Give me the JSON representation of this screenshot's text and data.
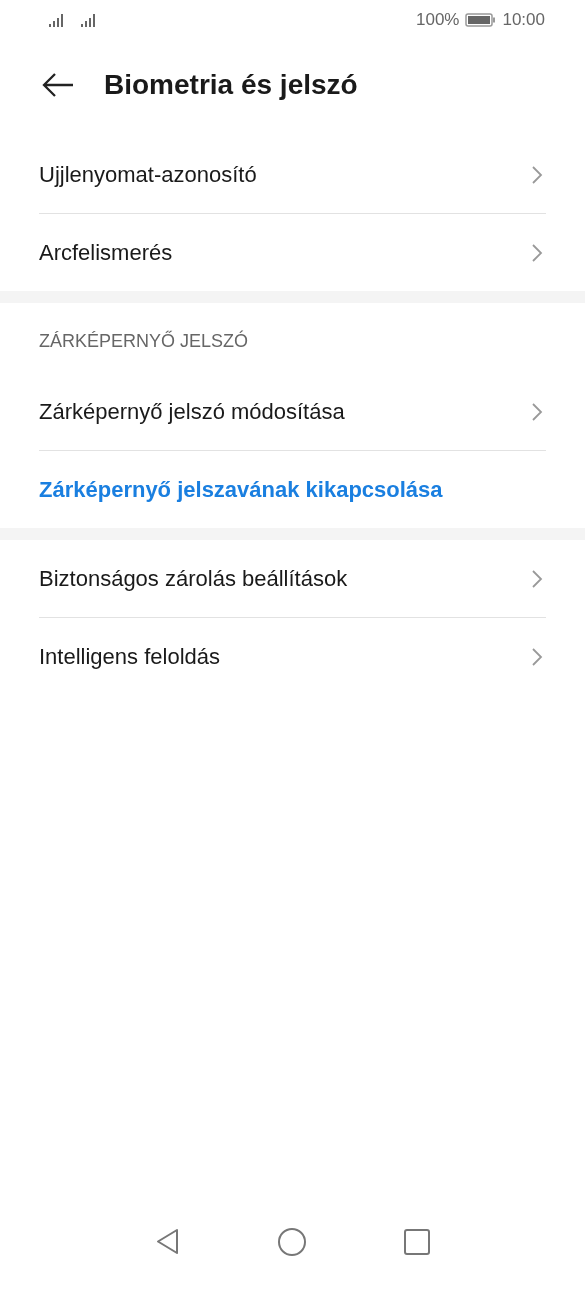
{
  "status_bar": {
    "battery_percent": "100%",
    "time": "10:00"
  },
  "header": {
    "title": "Biometria és jelszó"
  },
  "groups": [
    {
      "items": [
        {
          "kind": "nav",
          "label": "Ujjlenyomat-azonosító"
        },
        {
          "kind": "nav",
          "label": "Arcfelismerés"
        }
      ]
    },
    {
      "heading": "ZÁRKÉPERNYŐ JELSZÓ",
      "items": [
        {
          "kind": "nav",
          "label": "Zárképernyő jelszó módosítása"
        },
        {
          "kind": "action",
          "label": "Zárképernyő jelszavának kikapcsolása"
        }
      ]
    },
    {
      "items": [
        {
          "kind": "nav",
          "label": "Biztonságos zárolás beállítások"
        },
        {
          "kind": "nav",
          "label": "Intelligens feloldás"
        }
      ]
    }
  ]
}
